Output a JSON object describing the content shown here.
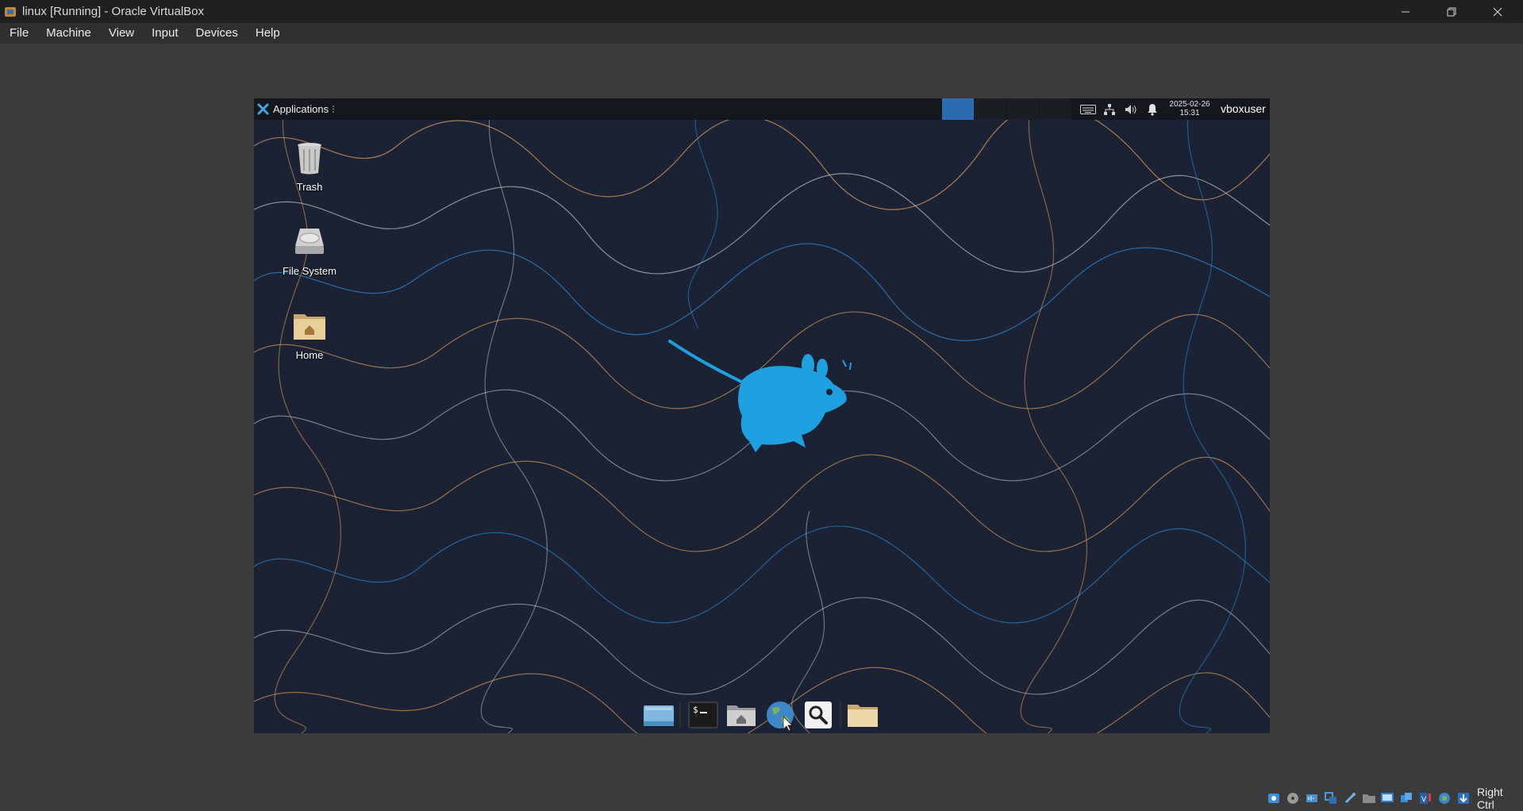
{
  "window": {
    "title": "linux [Running] - Oracle VirtualBox",
    "controls": [
      "minimize-icon",
      "restore-icon",
      "close-icon"
    ]
  },
  "menubar": {
    "items": [
      {
        "label": "File"
      },
      {
        "label": "Machine"
      },
      {
        "label": "View"
      },
      {
        "label": "Input"
      },
      {
        "label": "Devices"
      },
      {
        "label": "Help"
      }
    ]
  },
  "guest": {
    "panel": {
      "applications_label": "Applications",
      "workspaces": [
        {
          "active": true
        },
        {
          "active": false
        },
        {
          "active": false
        },
        {
          "active": false
        }
      ],
      "tray_icons": [
        "keyboard-icon",
        "network-icon",
        "volume-icon",
        "notification-bell-icon"
      ],
      "clock": {
        "date": "2025-02-26",
        "time": "15:31"
      },
      "user": "vboxuser"
    },
    "desktop_icons": [
      {
        "label": "Trash",
        "icon": "trash-icon"
      },
      {
        "label": "File System",
        "icon": "drive-icon"
      },
      {
        "label": "Home",
        "icon": "home-folder-icon"
      }
    ],
    "dock": {
      "items": [
        {
          "name": "show-desktop",
          "icon": "show-desktop-icon"
        },
        {
          "name": "terminal",
          "icon": "terminal-icon"
        },
        {
          "name": "file-manager",
          "icon": "home-folder-icon"
        },
        {
          "name": "web-browser",
          "icon": "globe-icon"
        },
        {
          "name": "app-finder",
          "icon": "search-icon"
        },
        {
          "name": "folder",
          "icon": "folder-icon"
        }
      ]
    },
    "colors": {
      "panel": "#14171c",
      "workspace_active": "#2b6cb0",
      "wallpaper_bg": "#1a2233",
      "mouse_logo": "#1ea1e0"
    }
  },
  "statusbar": {
    "icons": [
      "hard-disk-icon",
      "optical-drive-icon",
      "audio-icon",
      "network-adapter-icon",
      "usb-icon",
      "shared-folder-icon",
      "display-icon",
      "video-capture-icon",
      "recording-icon",
      "cpu-icon",
      "mouse-integration-icon",
      "keyboard-capture-icon"
    ],
    "host_key": "Right Ctrl"
  }
}
